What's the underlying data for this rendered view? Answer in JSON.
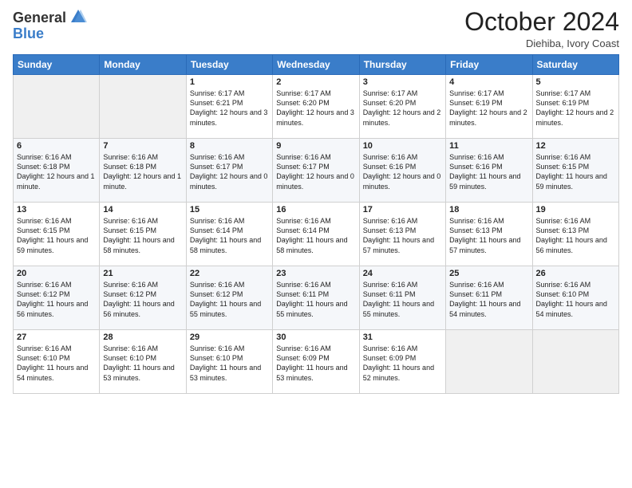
{
  "logo": {
    "text_general": "General",
    "text_blue": "Blue"
  },
  "header": {
    "month": "October 2024",
    "location": "Diehiba, Ivory Coast"
  },
  "weekdays": [
    "Sunday",
    "Monday",
    "Tuesday",
    "Wednesday",
    "Thursday",
    "Friday",
    "Saturday"
  ],
  "weeks": [
    [
      {
        "day": "",
        "text": ""
      },
      {
        "day": "",
        "text": ""
      },
      {
        "day": "1",
        "text": "Sunrise: 6:17 AM\nSunset: 6:21 PM\nDaylight: 12 hours and 3 minutes."
      },
      {
        "day": "2",
        "text": "Sunrise: 6:17 AM\nSunset: 6:20 PM\nDaylight: 12 hours and 3 minutes."
      },
      {
        "day": "3",
        "text": "Sunrise: 6:17 AM\nSunset: 6:20 PM\nDaylight: 12 hours and 2 minutes."
      },
      {
        "day": "4",
        "text": "Sunrise: 6:17 AM\nSunset: 6:19 PM\nDaylight: 12 hours and 2 minutes."
      },
      {
        "day": "5",
        "text": "Sunrise: 6:17 AM\nSunset: 6:19 PM\nDaylight: 12 hours and 2 minutes."
      }
    ],
    [
      {
        "day": "6",
        "text": "Sunrise: 6:16 AM\nSunset: 6:18 PM\nDaylight: 12 hours and 1 minute."
      },
      {
        "day": "7",
        "text": "Sunrise: 6:16 AM\nSunset: 6:18 PM\nDaylight: 12 hours and 1 minute."
      },
      {
        "day": "8",
        "text": "Sunrise: 6:16 AM\nSunset: 6:17 PM\nDaylight: 12 hours and 0 minutes."
      },
      {
        "day": "9",
        "text": "Sunrise: 6:16 AM\nSunset: 6:17 PM\nDaylight: 12 hours and 0 minutes."
      },
      {
        "day": "10",
        "text": "Sunrise: 6:16 AM\nSunset: 6:16 PM\nDaylight: 12 hours and 0 minutes."
      },
      {
        "day": "11",
        "text": "Sunrise: 6:16 AM\nSunset: 6:16 PM\nDaylight: 11 hours and 59 minutes."
      },
      {
        "day": "12",
        "text": "Sunrise: 6:16 AM\nSunset: 6:15 PM\nDaylight: 11 hours and 59 minutes."
      }
    ],
    [
      {
        "day": "13",
        "text": "Sunrise: 6:16 AM\nSunset: 6:15 PM\nDaylight: 11 hours and 59 minutes."
      },
      {
        "day": "14",
        "text": "Sunrise: 6:16 AM\nSunset: 6:15 PM\nDaylight: 11 hours and 58 minutes."
      },
      {
        "day": "15",
        "text": "Sunrise: 6:16 AM\nSunset: 6:14 PM\nDaylight: 11 hours and 58 minutes."
      },
      {
        "day": "16",
        "text": "Sunrise: 6:16 AM\nSunset: 6:14 PM\nDaylight: 11 hours and 58 minutes."
      },
      {
        "day": "17",
        "text": "Sunrise: 6:16 AM\nSunset: 6:13 PM\nDaylight: 11 hours and 57 minutes."
      },
      {
        "day": "18",
        "text": "Sunrise: 6:16 AM\nSunset: 6:13 PM\nDaylight: 11 hours and 57 minutes."
      },
      {
        "day": "19",
        "text": "Sunrise: 6:16 AM\nSunset: 6:13 PM\nDaylight: 11 hours and 56 minutes."
      }
    ],
    [
      {
        "day": "20",
        "text": "Sunrise: 6:16 AM\nSunset: 6:12 PM\nDaylight: 11 hours and 56 minutes."
      },
      {
        "day": "21",
        "text": "Sunrise: 6:16 AM\nSunset: 6:12 PM\nDaylight: 11 hours and 56 minutes."
      },
      {
        "day": "22",
        "text": "Sunrise: 6:16 AM\nSunset: 6:12 PM\nDaylight: 11 hours and 55 minutes."
      },
      {
        "day": "23",
        "text": "Sunrise: 6:16 AM\nSunset: 6:11 PM\nDaylight: 11 hours and 55 minutes."
      },
      {
        "day": "24",
        "text": "Sunrise: 6:16 AM\nSunset: 6:11 PM\nDaylight: 11 hours and 55 minutes."
      },
      {
        "day": "25",
        "text": "Sunrise: 6:16 AM\nSunset: 6:11 PM\nDaylight: 11 hours and 54 minutes."
      },
      {
        "day": "26",
        "text": "Sunrise: 6:16 AM\nSunset: 6:10 PM\nDaylight: 11 hours and 54 minutes."
      }
    ],
    [
      {
        "day": "27",
        "text": "Sunrise: 6:16 AM\nSunset: 6:10 PM\nDaylight: 11 hours and 54 minutes."
      },
      {
        "day": "28",
        "text": "Sunrise: 6:16 AM\nSunset: 6:10 PM\nDaylight: 11 hours and 53 minutes."
      },
      {
        "day": "29",
        "text": "Sunrise: 6:16 AM\nSunset: 6:10 PM\nDaylight: 11 hours and 53 minutes."
      },
      {
        "day": "30",
        "text": "Sunrise: 6:16 AM\nSunset: 6:09 PM\nDaylight: 11 hours and 53 minutes."
      },
      {
        "day": "31",
        "text": "Sunrise: 6:16 AM\nSunset: 6:09 PM\nDaylight: 11 hours and 52 minutes."
      },
      {
        "day": "",
        "text": ""
      },
      {
        "day": "",
        "text": ""
      }
    ]
  ]
}
